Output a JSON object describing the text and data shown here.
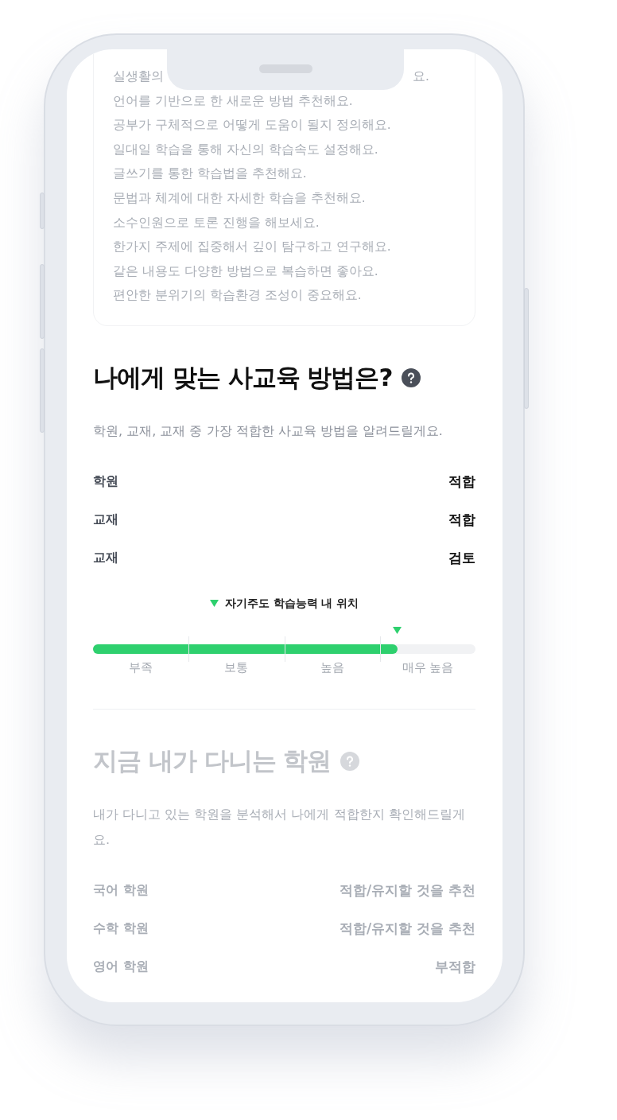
{
  "tips_card": {
    "dimmed": true,
    "first_line_fragments": [
      "실생활의",
      "요."
    ],
    "lines": [
      "언어를 기반으로 한 새로운 방법 추천해요.",
      "공부가 구체적으로 어떻게 도움이 될지 정의해요.",
      "일대일 학습을 통해 자신의 학습속도 설정해요.",
      "글쓰기를 통한 학습법을 추천해요.",
      "문법과 체계에 대한 자세한 학습을 추천해요.",
      "소수인원으로 토론 진행을 해보세요.",
      "한가지 주제에 집중해서 깊이 탐구하고 연구해요.",
      "같은 내용도 다양한 방법으로 복습하면 좋아요.",
      "편안한 분위기의 학습환경 조성이 중요해요."
    ]
  },
  "sections": [
    {
      "title": "나에게 맞는 사교육 방법은?",
      "dimmed": false,
      "description": "학원, 교재, 교재 중 가장 적합한 사교육 방법을 알려드릴게요.",
      "rows": [
        {
          "label": "학원",
          "value": "적합"
        },
        {
          "label": "교재",
          "value": "적합"
        },
        {
          "label": "교재",
          "value": "검토"
        }
      ],
      "position_meter": {
        "legend": "자기주도 학습능력 내 위치",
        "level": 0.796,
        "scale": [
          "부족",
          "보통",
          "높음",
          "매우 높음"
        ]
      }
    },
    {
      "title": "지금 내가 다니는 학원",
      "dimmed": true,
      "description": "내가 다니고 있는 학원을 분석해서 나에게 적합한지 확인해드릴게요.",
      "rows": [
        {
          "label": "국어 학원",
          "value": "적합/유지할 것을 추천"
        },
        {
          "label": "수학 학원",
          "value": "적합/유지할 것을 추천"
        },
        {
          "label": "영어 학원",
          "value": "부적합"
        }
      ]
    }
  ]
}
